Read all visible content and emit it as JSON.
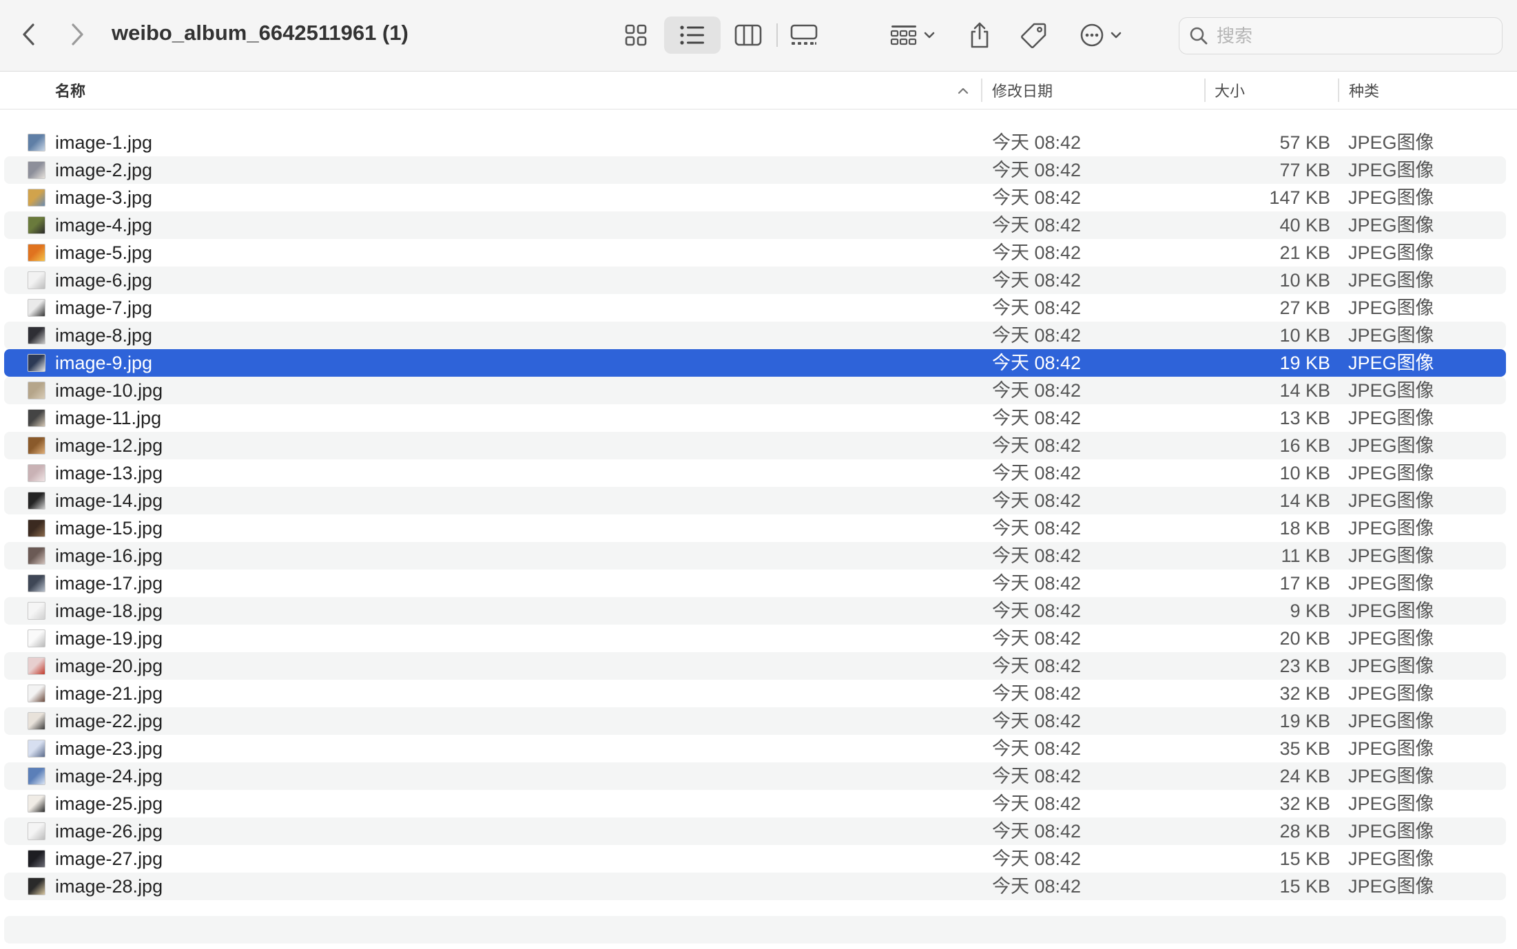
{
  "window": {
    "title": "weibo_album_6642511961 (1)"
  },
  "toolbar": {
    "icons": [
      "chevron-left-icon",
      "chevron-right-icon",
      "icon-view-icon",
      "list-view-icon",
      "column-view-icon",
      "gallery-view-icon",
      "group-icon",
      "share-icon",
      "tag-icon",
      "more-icon"
    ],
    "active_view": "list"
  },
  "search": {
    "placeholder": "搜索",
    "value": ""
  },
  "columns": {
    "name": "名称",
    "date": "修改日期",
    "size": "大小",
    "kind": "种类"
  },
  "colors": {
    "selection": "#2e63d9",
    "alt_row": "#f4f5f5",
    "toolbar_bg": "#f5f5f5"
  },
  "files": [
    {
      "name": "image-1.jpg",
      "date": "今天 08:42",
      "size": "57 KB",
      "kind": "JPEG图像"
    },
    {
      "name": "image-2.jpg",
      "date": "今天 08:42",
      "size": "77 KB",
      "kind": "JPEG图像"
    },
    {
      "name": "image-3.jpg",
      "date": "今天 08:42",
      "size": "147 KB",
      "kind": "JPEG图像"
    },
    {
      "name": "image-4.jpg",
      "date": "今天 08:42",
      "size": "40 KB",
      "kind": "JPEG图像"
    },
    {
      "name": "image-5.jpg",
      "date": "今天 08:42",
      "size": "21 KB",
      "kind": "JPEG图像"
    },
    {
      "name": "image-6.jpg",
      "date": "今天 08:42",
      "size": "10 KB",
      "kind": "JPEG图像"
    },
    {
      "name": "image-7.jpg",
      "date": "今天 08:42",
      "size": "27 KB",
      "kind": "JPEG图像"
    },
    {
      "name": "image-8.jpg",
      "date": "今天 08:42",
      "size": "10 KB",
      "kind": "JPEG图像"
    },
    {
      "name": "image-9.jpg",
      "date": "今天 08:42",
      "size": "19 KB",
      "kind": "JPEG图像",
      "selected": true
    },
    {
      "name": "image-10.jpg",
      "date": "今天 08:42",
      "size": "14 KB",
      "kind": "JPEG图像"
    },
    {
      "name": "image-11.jpg",
      "date": "今天 08:42",
      "size": "13 KB",
      "kind": "JPEG图像"
    },
    {
      "name": "image-12.jpg",
      "date": "今天 08:42",
      "size": "16 KB",
      "kind": "JPEG图像"
    },
    {
      "name": "image-13.jpg",
      "date": "今天 08:42",
      "size": "10 KB",
      "kind": "JPEG图像"
    },
    {
      "name": "image-14.jpg",
      "date": "今天 08:42",
      "size": "14 KB",
      "kind": "JPEG图像"
    },
    {
      "name": "image-15.jpg",
      "date": "今天 08:42",
      "size": "18 KB",
      "kind": "JPEG图像"
    },
    {
      "name": "image-16.jpg",
      "date": "今天 08:42",
      "size": "11 KB",
      "kind": "JPEG图像"
    },
    {
      "name": "image-17.jpg",
      "date": "今天 08:42",
      "size": "17 KB",
      "kind": "JPEG图像"
    },
    {
      "name": "image-18.jpg",
      "date": "今天 08:42",
      "size": "9 KB",
      "kind": "JPEG图像"
    },
    {
      "name": "image-19.jpg",
      "date": "今天 08:42",
      "size": "20 KB",
      "kind": "JPEG图像"
    },
    {
      "name": "image-20.jpg",
      "date": "今天 08:42",
      "size": "23 KB",
      "kind": "JPEG图像"
    },
    {
      "name": "image-21.jpg",
      "date": "今天 08:42",
      "size": "32 KB",
      "kind": "JPEG图像"
    },
    {
      "name": "image-22.jpg",
      "date": "今天 08:42",
      "size": "19 KB",
      "kind": "JPEG图像"
    },
    {
      "name": "image-23.jpg",
      "date": "今天 08:42",
      "size": "35 KB",
      "kind": "JPEG图像"
    },
    {
      "name": "image-24.jpg",
      "date": "今天 08:42",
      "size": "24 KB",
      "kind": "JPEG图像"
    },
    {
      "name": "image-25.jpg",
      "date": "今天 08:42",
      "size": "32 KB",
      "kind": "JPEG图像"
    },
    {
      "name": "image-26.jpg",
      "date": "今天 08:42",
      "size": "28 KB",
      "kind": "JPEG图像"
    },
    {
      "name": "image-27.jpg",
      "date": "今天 08:42",
      "size": "15 KB",
      "kind": "JPEG图像"
    },
    {
      "name": "image-28.jpg",
      "date": "今天 08:42",
      "size": "15 KB",
      "kind": "JPEG图像"
    }
  ]
}
